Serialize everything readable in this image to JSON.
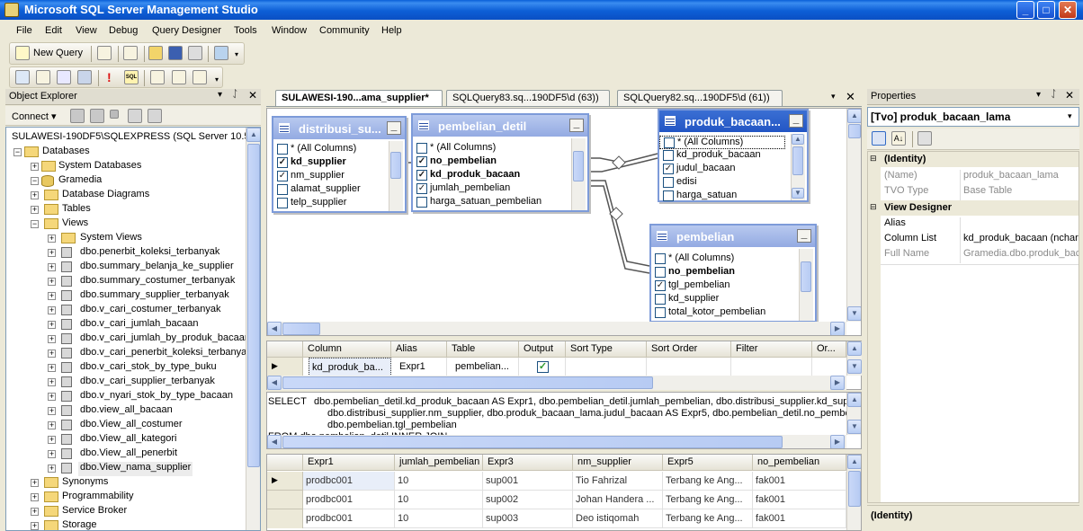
{
  "window": {
    "title": "Microsoft SQL Server Management Studio"
  },
  "menu": [
    "File",
    "Edit",
    "View",
    "Debug",
    "Query Designer",
    "Tools",
    "Window",
    "Community",
    "Help"
  ],
  "toolbar": {
    "new_query_label": "New Query",
    "sql_badge": "SQL"
  },
  "object_explorer": {
    "title": "Object Explorer",
    "connect_label": "Connect",
    "server": "SULAWESI-190DF5\\SQLEXPRESS (SQL Server 10.50.1",
    "databases": "Databases",
    "system_databases": "System Databases",
    "gramedia": "Gramedia",
    "database_diagrams": "Database Diagrams",
    "tables": "Tables",
    "views": "Views",
    "system_views": "System Views",
    "view_items": [
      "dbo.penerbit_koleksi_terbanyak",
      "dbo.summary_belanja_ke_supplier",
      "dbo.summary_costumer_terbanyak",
      "dbo.summary_supplier_terbanyak",
      "dbo.v_cari_costumer_terbanyak",
      "dbo.v_cari_jumlah_bacaan",
      "dbo.v_cari_jumlah_by_produk_bacaar",
      "dbo.v_cari_penerbit_koleksi_terbanya",
      "dbo.v_cari_stok_by_type_buku",
      "dbo.v_cari_supplier_terbanyak",
      "dbo.v_nyari_stok_by_type_bacaan",
      "dbo.view_all_bacaan",
      "dbo.View_all_costumer",
      "dbo.View_all_kategori",
      "dbo.View_all_penerbit",
      "dbo.View_nama_supplier"
    ],
    "synonyms": "Synonyms",
    "programmability": "Programmability",
    "service_broker": "Service Broker",
    "storage": "Storage"
  },
  "tabs": [
    "SULAWESI-190...ama_supplier*",
    "SQLQuery83.sq...190DF5\\d (63))",
    "SQLQuery82.sq...190DF5\\d (61))"
  ],
  "diagram": {
    "tables": [
      {
        "title": "distribusi_su...",
        "columns": [
          {
            "name": "* (All Columns)",
            "checked": false,
            "bold": false
          },
          {
            "name": "kd_supplier",
            "checked": true,
            "bold": true
          },
          {
            "name": "nm_supplier",
            "checked": true,
            "bold": false
          },
          {
            "name": "alamat_supplier",
            "checked": false,
            "bold": false
          },
          {
            "name": "telp_supplier",
            "checked": false,
            "bold": false
          }
        ]
      },
      {
        "title": "pembelian_detil",
        "columns": [
          {
            "name": "* (All Columns)",
            "checked": false,
            "bold": false
          },
          {
            "name": "no_pembelian",
            "checked": true,
            "bold": true
          },
          {
            "name": "kd_produk_bacaan",
            "checked": true,
            "bold": true
          },
          {
            "name": "jumlah_pembelian",
            "checked": true,
            "bold": false
          },
          {
            "name": "harga_satuan_pembelian",
            "checked": false,
            "bold": false
          }
        ]
      },
      {
        "title": "produk_bacaan...",
        "columns": [
          {
            "name": "* (All Columns)",
            "checked": false,
            "bold": false
          },
          {
            "name": "kd_produk_bacaan",
            "checked": false,
            "bold": false
          },
          {
            "name": "judul_bacaan",
            "checked": true,
            "bold": false
          },
          {
            "name": "edisi",
            "checked": false,
            "bold": false
          },
          {
            "name": "harga_satuan",
            "checked": false,
            "bold": false
          }
        ]
      },
      {
        "title": "pembelian",
        "columns": [
          {
            "name": "* (All Columns)",
            "checked": false,
            "bold": false
          },
          {
            "name": "no_pembelian",
            "checked": false,
            "bold": true
          },
          {
            "name": "tgl_pembelian",
            "checked": true,
            "bold": false
          },
          {
            "name": "kd_supplier",
            "checked": false,
            "bold": false
          },
          {
            "name": "total_kotor_pembelian",
            "checked": false,
            "bold": false
          }
        ]
      }
    ]
  },
  "criteria": {
    "headers": [
      "Column",
      "Alias",
      "Table",
      "Output",
      "Sort Type",
      "Sort Order",
      "Filter",
      "Or..."
    ],
    "row": {
      "column": "kd_produk_ba...",
      "alias": "Expr1",
      "table": "pembelian...",
      "output": true
    }
  },
  "sql": {
    "line1_keyword": "SELECT",
    "line1": "dbo.pembelian_detil.kd_produk_bacaan AS Expr1, dbo.pembelian_detil.jumlah_pembelian, dbo.distribusi_supplier.kd_suppli",
    "line2": "dbo.distribusi_supplier.nm_supplier, dbo.produk_bacaan_lama.judul_bacaan AS Expr5, dbo.pembelian_detil.no_pembeli",
    "line3": "dbo.pembelian.tgl_pembelian",
    "line4": "FROM        dbo.pembelian_detil INNER JOIN"
  },
  "results": {
    "headers": [
      "Expr1",
      "jumlah_pembelian",
      "Expr3",
      "nm_supplier",
      "Expr5",
      "no_pembelian"
    ],
    "rows": [
      [
        "prodbc001",
        "10",
        "sup001",
        "Tio Fahrizal",
        "Terbang ke Ang...",
        "fak001"
      ],
      [
        "prodbc001",
        "10",
        "sup002",
        "Johan Handera ...",
        "Terbang ke Ang...",
        "fak001"
      ],
      [
        "prodbc001",
        "10",
        "sup003",
        "Deo istiqomah",
        "Terbang ke Ang...",
        "fak001"
      ]
    ]
  },
  "properties": {
    "title": "Properties",
    "object": "[Tvo] produk_bacaan_lama",
    "cat_identity": "(Identity)",
    "name_label": "(Name)",
    "name_value": "produk_bacaan_lama",
    "type_label": "TVO Type",
    "type_value": "Base Table",
    "cat_view_designer": "View Designer",
    "alias_label": "Alias",
    "alias_value": "",
    "column_list_label": "Column List",
    "column_list_value": "kd_produk_bacaan (nchar(",
    "full_name_label": "Full Name",
    "full_name_value": "Gramedia.dbo.produk_bac",
    "footer": "(Identity)"
  },
  "colors": {
    "title_blue": "#0a5fd8",
    "selected_table_head": "#2255c4",
    "check_green": "#2f9a2f"
  }
}
